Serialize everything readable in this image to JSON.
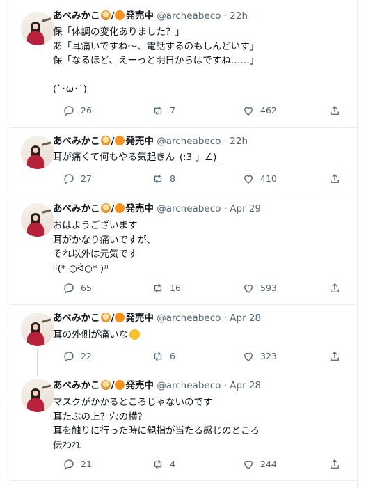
{
  "tweets": [
    {
      "name": "あべみかこ",
      "status": "発売中",
      "handle": "@archeabeco",
      "dot": "·",
      "time": "22h",
      "text": "保「体調の変化ありました？」\nあ「耳痛いですね～、電話するのもしんどいす」\n保「なるほど、えーっと明日からはですね……」\n\n(˙･ω･˙)",
      "replies": "26",
      "retweets": "7",
      "likes": "462"
    },
    {
      "name": "あべみかこ",
      "status": "発売中",
      "handle": "@archeabeco",
      "dot": "·",
      "time": "22h",
      "text": "耳が痛くて何もやる気起きん_(:3 」∠)_",
      "replies": "27",
      "retweets": "8",
      "likes": "410"
    },
    {
      "name": "あべみかこ",
      "status": "発売中",
      "handle": "@archeabeco",
      "dot": "·",
      "time": "Apr 29",
      "text": "おはようございます\n耳がかなり痛いですが、\nそれ以外は元気です\n⁽⁽(* ○ᐛ○* )⁾⁾",
      "replies": "65",
      "retweets": "16",
      "likes": "593"
    },
    {
      "name": "あべみかこ",
      "status": "発売中",
      "handle": "@archeabeco",
      "dot": "·",
      "time": "Apr 28",
      "text": "耳の外側が痛いな",
      "replies": "22",
      "retweets": "6",
      "likes": "323"
    },
    {
      "name": "あべみかこ",
      "status": "発売中",
      "handle": "@archeabeco",
      "dot": "·",
      "time": "Apr 28",
      "text": "マスクがかかるところじゃないのです\n耳たぶの上？穴の横？\n耳を触りに行った時に親指が当たる感じのところ\n伝われ",
      "replies": "21",
      "retweets": "4",
      "likes": "244"
    }
  ]
}
